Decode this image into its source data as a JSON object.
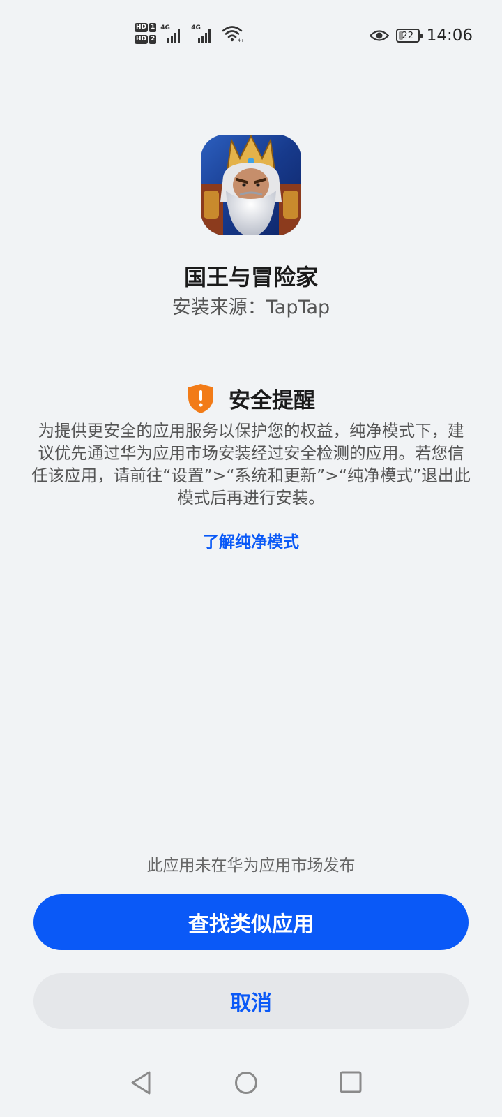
{
  "status_bar": {
    "sim1": "HD",
    "sim1_index": "1",
    "sim2": "HD",
    "sim2_index": "2",
    "net1": "4G",
    "net2": "4G",
    "battery_level": "22",
    "time": "14:06",
    "icons": [
      "signal-icon",
      "wifi-icon",
      "eye-comfort-icon",
      "battery-icon"
    ]
  },
  "app": {
    "icon": "app-icon-king-portrait",
    "name": "国王与冒险家",
    "source": "安装来源：TapTap"
  },
  "security": {
    "icon": "shield-warning-icon",
    "icon_color": "#f27b17",
    "title": "安全提醒",
    "body": "为提供更安全的应用服务以保护您的权益，纯净模式下，建议优先通过华为应用市场安装经过安全检测的应用。若您信任该应用，请前往“设置”>“系统和更新”>“纯净模式”退出此模式后再进行安装。",
    "learn_more": "了解纯净模式"
  },
  "footer": {
    "notice": "此应用未在华为应用市场发布",
    "primary_button": "查找类似应用",
    "cancel_button": "取消",
    "accent_color": "#0a59f7"
  },
  "navbar": {
    "icons": [
      "back-icon",
      "home-icon",
      "recents-icon"
    ]
  }
}
